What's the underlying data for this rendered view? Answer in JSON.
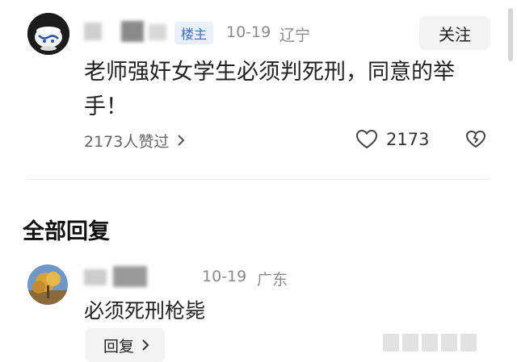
{
  "post": {
    "author_badge": "楼主",
    "date": "10-19",
    "location": "辽宁",
    "follow_label": "关注",
    "content": "老师强奸女学生必须判死刑，同意的举手！",
    "likers_summary": "2173人赞过",
    "like_count": "2173"
  },
  "replies_section": {
    "title": "全部回复",
    "items": [
      {
        "date": "10-19",
        "location": "广东",
        "content": "必须死刑枪毙",
        "reply_label": "回复"
      }
    ]
  },
  "colors": {
    "badge_bg": "#e9f0fb",
    "badge_text": "#3d6bc4",
    "button_bg": "#f3f3f3",
    "meta_text": "#8a8a8a"
  }
}
